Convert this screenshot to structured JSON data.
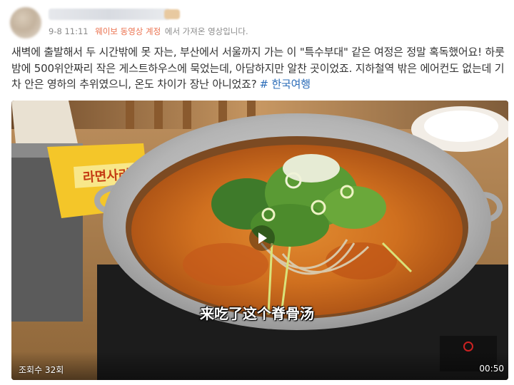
{
  "header": {
    "timestamp": "9-8 11:11",
    "source_label": "웨이보 동영상 계정",
    "source_suffix": "에서 가져온 영상입니다."
  },
  "post": {
    "text": "새벽에 출발해서 두 시간밖에 못 자는, 부산에서 서울까지 가는 이 \"특수부대\" 같은 여정은 정말 혹독했어요! 하룻밤에 500위안짜리 작은 게스트하우스에 묵었는데, 아담하지만 알찬 곳이었죠. 지하철역 밖은 에어컨도 없는데 기차 안은 영하의 추위였으니, 온도 차이가 장난 아니었죠?",
    "hashtag": "# 한국여행"
  },
  "video": {
    "subtitle": "来吃了这个脊骨汤",
    "view_count": "조회수 32회",
    "duration": "00:50",
    "package_text": "라면사리"
  },
  "colors": {
    "source_link": "#eb7350",
    "hashtag": "#2b6cb8",
    "text": "#333333",
    "meta": "#8a8a8a"
  }
}
